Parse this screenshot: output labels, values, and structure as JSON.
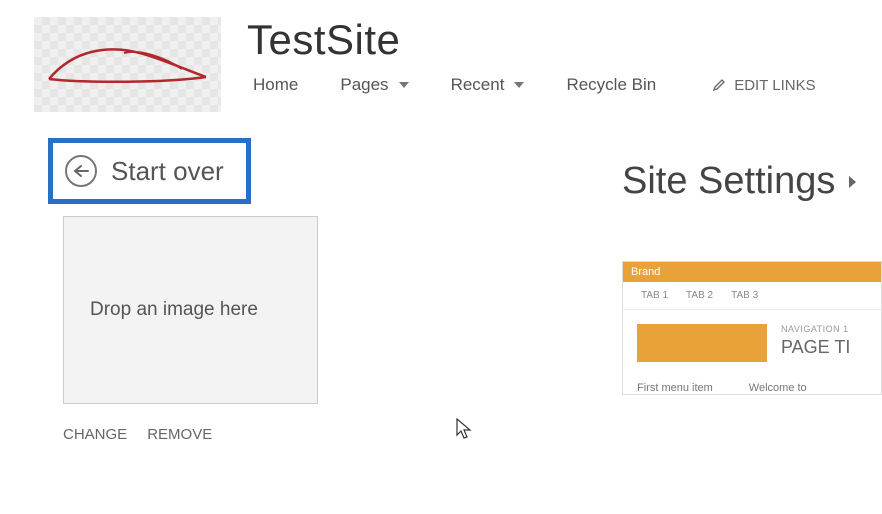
{
  "site": {
    "title": "TestSite"
  },
  "nav": {
    "home": "Home",
    "pages": "Pages",
    "recent": "Recent",
    "recycle": "Recycle Bin",
    "edit_links": "EDIT LINKS"
  },
  "start_over": {
    "label": "Start over"
  },
  "drop_zone": {
    "text": "Drop an image here",
    "change": "CHANGE",
    "remove": "REMOVE"
  },
  "right": {
    "heading": "Site Settings"
  },
  "preview": {
    "brand": "Brand",
    "tabs": {
      "t1": "TAB 1",
      "t2": "TAB 2",
      "t3": "TAB 3"
    },
    "nav1": "NAVIGATION 1",
    "page_title": "PAGE TI",
    "menu1": "First menu item",
    "welcome": "Welcome to"
  }
}
